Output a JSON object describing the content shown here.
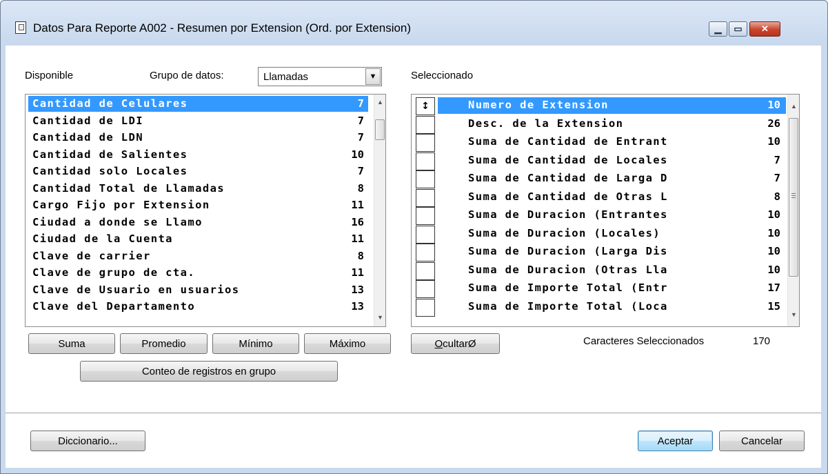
{
  "window": {
    "title": "Datos Para Reporte A002 - Resumen por Extension (Ord. por Extension)",
    "minimize_glyph": "▁",
    "maximize_glyph": "▭",
    "close_glyph": "✕"
  },
  "left": {
    "label": "Disponible",
    "group_label": "Grupo de datos:",
    "group_value": "Llamadas",
    "items": [
      {
        "name": "Cantidad de Celulares",
        "len": "7"
      },
      {
        "name": "Cantidad de LDI",
        "len": "7"
      },
      {
        "name": "Cantidad de LDN",
        "len": "7"
      },
      {
        "name": "Cantidad de Salientes",
        "len": "10"
      },
      {
        "name": "Cantidad solo Locales",
        "len": "7"
      },
      {
        "name": "Cantidad Total de Llamadas",
        "len": "8"
      },
      {
        "name": "Cargo Fijo por Extension",
        "len": "11"
      },
      {
        "name": "Ciudad a donde se Llamo",
        "len": "16"
      },
      {
        "name": "Ciudad de la Cuenta",
        "len": "11"
      },
      {
        "name": "Clave de carrier",
        "len": "8"
      },
      {
        "name": "Clave de grupo de cta.",
        "len": "11"
      },
      {
        "name": "Clave de Usuario en usuarios",
        "len": "13"
      },
      {
        "name": "Clave del Departamento",
        "len": "13"
      }
    ],
    "buttons": {
      "suma": "Suma",
      "promedio": "Promedio",
      "minimo": "Mínimo",
      "maximo": "Máximo",
      "conteo": "Conteo de registros en grupo"
    }
  },
  "right": {
    "label": "Seleccionado",
    "items": [
      {
        "mark": "↕",
        "name": "Numero de Extension",
        "len": "10"
      },
      {
        "mark": "",
        "name": "Desc. de la Extension",
        "len": "26"
      },
      {
        "mark": "",
        "name": "Suma de Cantidad de Entrant",
        "len": "10"
      },
      {
        "mark": "",
        "name": "Suma de Cantidad de Locales",
        "len": "7"
      },
      {
        "mark": "",
        "name": "Suma de Cantidad de Larga D",
        "len": "7"
      },
      {
        "mark": "",
        "name": "Suma de Cantidad de Otras L",
        "len": "8"
      },
      {
        "mark": "",
        "name": "Suma de Duracion (Entrantes",
        "len": "10"
      },
      {
        "mark": "",
        "name": "Suma de Duracion (Locales)",
        "len": "10"
      },
      {
        "mark": "",
        "name": "Suma de Duracion (Larga Dis",
        "len": "10"
      },
      {
        "mark": "",
        "name": "Suma de Duracion (Otras Lla",
        "len": "10"
      },
      {
        "mark": "",
        "name": "Suma de Importe Total (Entr",
        "len": "17"
      },
      {
        "mark": "",
        "name": "Suma de Importe Total (Loca",
        "len": "15"
      }
    ],
    "ocultar_label_underlined": "O",
    "ocultar_label_rest": "cultarØ",
    "chars_label": "Caracteres Seleccionados",
    "chars_value": "170"
  },
  "footer": {
    "diccionario": "Diccionario...",
    "aceptar": "Aceptar",
    "cancelar": "Cancelar"
  },
  "colors": {
    "selection": "#3399ff",
    "window_frame": "#c9d9ee",
    "close_button": "#c8442c"
  }
}
